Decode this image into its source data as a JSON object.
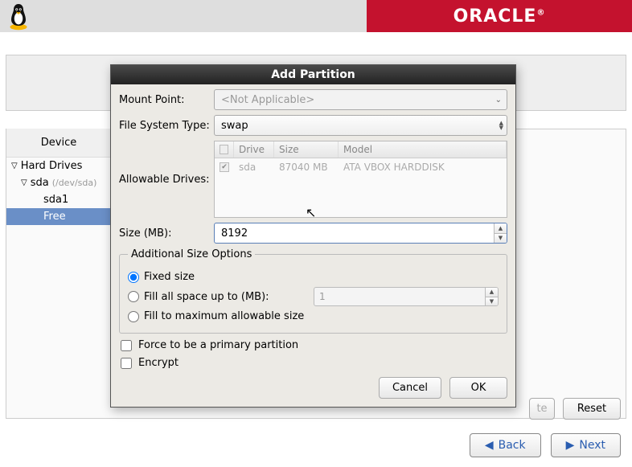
{
  "header": {
    "brand": "ORACLE"
  },
  "tree": {
    "header": "Device",
    "hard_drives": "Hard Drives",
    "sda": "sda",
    "sda_path": "(/dev/sda)",
    "sda1": "sda1",
    "free": "Free"
  },
  "dialog": {
    "title": "Add Partition",
    "mount_label": "Mount Point:",
    "mount_value": "<Not Applicable>",
    "fs_label": "File System Type:",
    "fs_value": "swap",
    "drives_label": "Allowable Drives:",
    "drive_cols": {
      "c1": "Drive",
      "c2": "Size",
      "c3": "Model"
    },
    "drive_row": {
      "name": "sda",
      "size": "87040 MB",
      "model": "ATA VBOX HARDDISK"
    },
    "size_label": "Size (MB):",
    "size_value": "8192",
    "opts_legend": "Additional Size Options",
    "opt_fixed": "Fixed size",
    "opt_fill_upto": "Fill all space up to (MB):",
    "opt_fill_upto_value": "1",
    "opt_fill_max": "Fill to maximum allowable size",
    "force_primary": "Force to be a primary partition",
    "encrypt": "Encrypt",
    "cancel": "Cancel",
    "ok": "OK"
  },
  "buttons": {
    "delete_frag": "te",
    "reset": "Reset",
    "back": "Back",
    "next": "Next"
  }
}
